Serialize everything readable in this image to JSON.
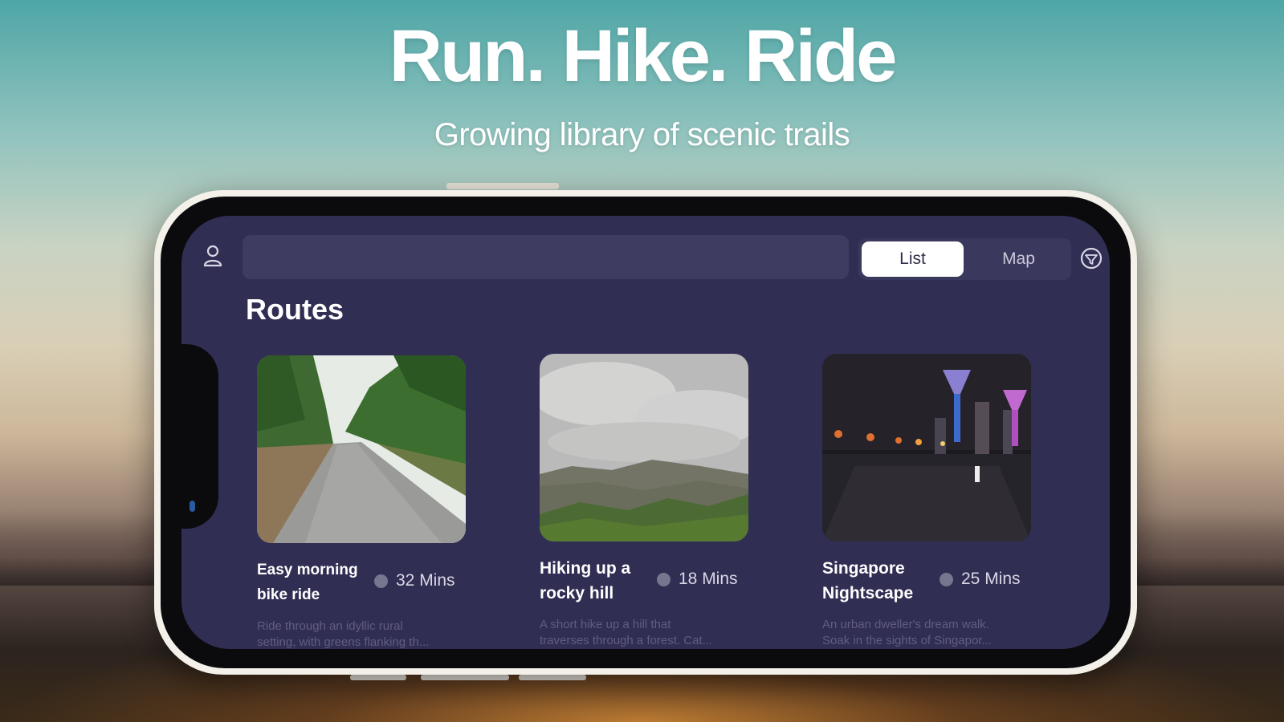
{
  "hero": {
    "title": "Run. Hike. Ride",
    "subtitle": "Growing library of scenic trails"
  },
  "app": {
    "segment": {
      "options": [
        "List",
        "Map"
      ],
      "selected": "List"
    },
    "section_title": "Routes",
    "routes": [
      {
        "title": "Easy morning bike ride",
        "duration": "32 Mins",
        "description": "Ride through an idyllic rural\nsetting, with greens flanking th..."
      },
      {
        "title": "Hiking up a rocky hill",
        "duration": "18 Mins",
        "description": "A short hike up a hill that\ntraverses through a forest. Cat..."
      },
      {
        "title": "Singapore Nightscape",
        "duration": "25 Mins",
        "description": "An urban dweller's dream walk.\nSoak in the sights of Singapor..."
      }
    ]
  },
  "colors": {
    "screen_bg": "#312e53",
    "search_bg": "#3e3c60",
    "segment_active": "#ffffff",
    "text_primary": "#ffffff",
    "text_muted": "#605d80"
  },
  "icons": [
    "profile-icon",
    "filter-icon"
  ]
}
